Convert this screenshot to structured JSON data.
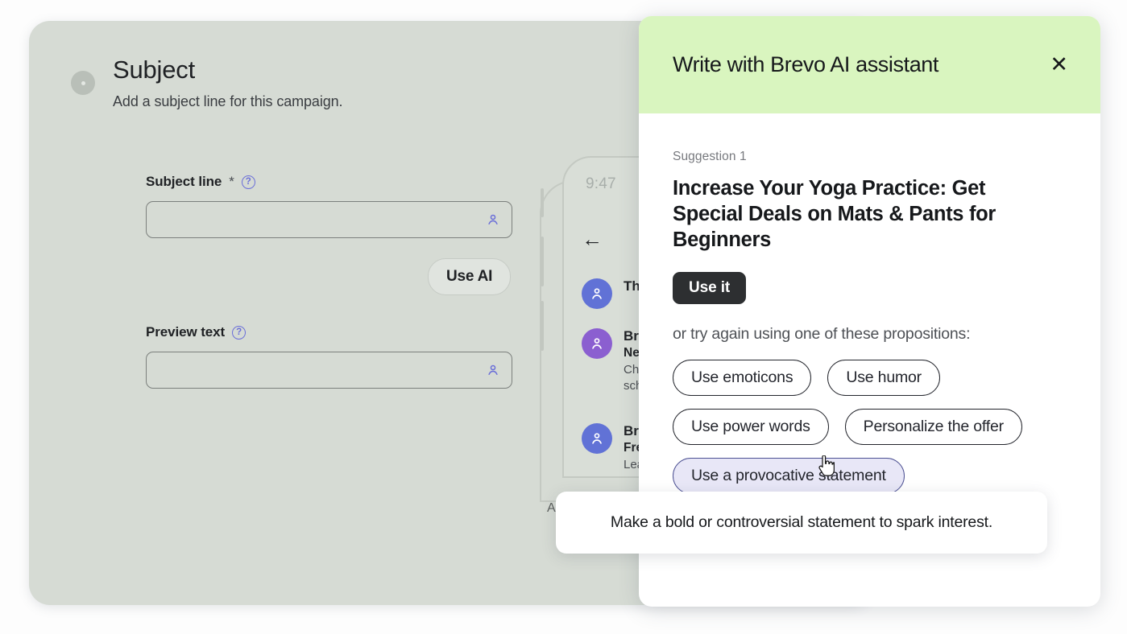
{
  "campaign": {
    "section_title": "Subject",
    "section_subtitle": "Add a subject line for this campaign.",
    "subject_label": "Subject line",
    "required_marker": "*",
    "subject_value": "",
    "subject_placeholder": "",
    "preview_label": "Preview text",
    "preview_value": "",
    "preview_placeholder": "",
    "use_ai_label": "Use AI",
    "help_glyph": "?",
    "person_icon": "person-icon"
  },
  "phone_preview": {
    "actual_label": "Actual",
    "status_time": "9:47",
    "back_arrow": "←",
    "messages": [
      {
        "sender": "The Gr",
        "subject": "",
        "snippet": "",
        "avatar_color": "#6172d6"
      },
      {
        "sender": "Brevo",
        "subject": "Need to",
        "snippet": "Choose\nscheduli",
        "avatar_color": "#8b5fd0"
      },
      {
        "sender": "Brevo .",
        "subject": "Free em",
        "snippet": "Learn ho",
        "avatar_color": "#6172d6"
      }
    ]
  },
  "ai_panel": {
    "title": "Write with Brevo AI assistant",
    "close_label": "✕",
    "header_color": "#d9f5bf",
    "suggestion_label": "Suggestion 1",
    "suggestion_text": "Increase Your Yoga Practice: Get Special Deals on Mats & Pants for Beginners",
    "use_it_label": "Use it",
    "try_again_text": "or try again using one of these propositions:",
    "chips": [
      {
        "label": "Use emoticons",
        "active": false
      },
      {
        "label": "Use humor",
        "active": false
      },
      {
        "label": "Use power words",
        "active": false
      },
      {
        "label": "Personalize the offer",
        "active": false
      },
      {
        "label": "Use a provocative statement",
        "active": true
      }
    ]
  },
  "tooltip": {
    "text": "Make a bold or controversial statement to spark interest."
  },
  "cursor": {
    "type": "pointer-hand"
  }
}
